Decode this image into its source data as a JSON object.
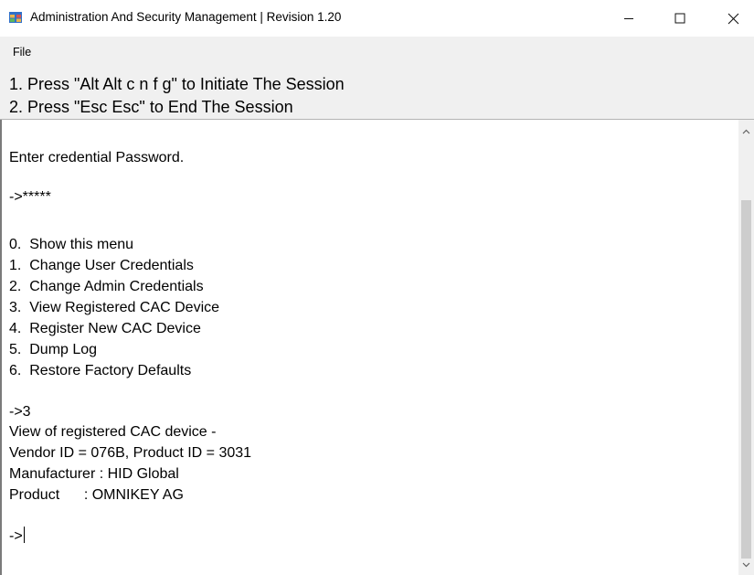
{
  "window": {
    "title": "Administration And Security Management | Revision 1.20",
    "app_icon": "app-window-icon"
  },
  "titlebar_buttons": {
    "minimize": "minimize-icon",
    "maximize": "maximize-icon",
    "close": "close-icon"
  },
  "menu": {
    "items": [
      "File"
    ]
  },
  "instructions": [
    "1. Press \"Alt Alt c n f g\" to Initiate The Session",
    "2. Press \"Esc Esc\" to End The Session"
  ],
  "console": {
    "lines": [
      "Enter credential Password.",
      "->*****",
      "0.  Show this menu",
      "1.  Change User Credentials",
      "2.  Change Admin Credentials",
      "3.  View Registered CAC Device",
      "4.  Register New CAC Device",
      "5.  Dump Log",
      "6.  Restore Factory Defaults",
      "->3",
      "View of registered CAC device -",
      "Vendor ID = 076B, Product ID = 3031",
      "Manufacturer : HID Global",
      "Product      : OMNIKEY AG",
      "->"
    ]
  },
  "colors": {
    "titlebar_bg": "#ffffff",
    "menubar_bg": "#f0f0f0",
    "console_bg": "#ffffff",
    "scroll_thumb": "#cdcdcd"
  }
}
